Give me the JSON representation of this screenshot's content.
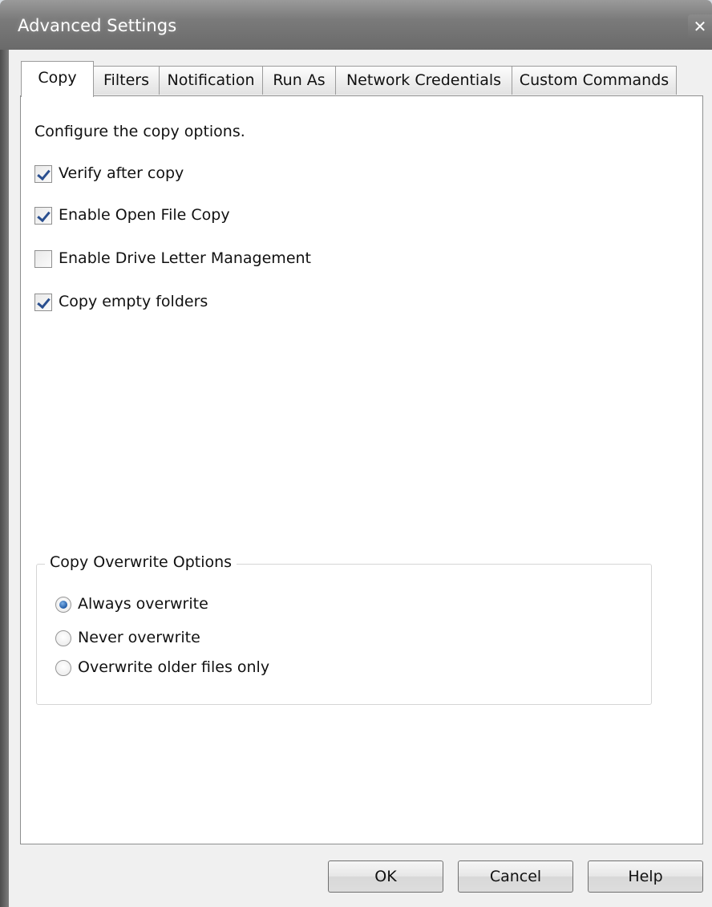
{
  "window": {
    "title": "Advanced Settings",
    "close_glyph": "✕"
  },
  "tabs": [
    {
      "label": "Copy",
      "active": true
    },
    {
      "label": "Filters",
      "active": false
    },
    {
      "label": "Notification",
      "active": false
    },
    {
      "label": "Run As",
      "active": false
    },
    {
      "label": "Network Credentials",
      "active": false
    },
    {
      "label": "Custom Commands",
      "active": false
    }
  ],
  "copy_tab": {
    "intro": "Configure the copy options.",
    "options": [
      {
        "label": "Verify after copy",
        "checked": true
      },
      {
        "label": "Enable Open File Copy",
        "checked": true
      },
      {
        "label": "Enable Drive Letter Management",
        "checked": false
      },
      {
        "label": "Copy empty folders",
        "checked": true
      }
    ],
    "overwrite_group": {
      "title": "Copy Overwrite Options",
      "choices": [
        {
          "label": "Always overwrite",
          "selected": true
        },
        {
          "label": "Never overwrite",
          "selected": false
        },
        {
          "label": "Overwrite older files only",
          "selected": false
        }
      ]
    }
  },
  "buttons": {
    "ok": "OK",
    "cancel": "Cancel",
    "help": "Help"
  },
  "icons": {
    "close": "close-icon",
    "checkmark": "checkmark-icon",
    "radio_dot": "radio-dot-icon"
  },
  "colors": {
    "titlebar": "#7a7a7a",
    "client_bg": "#f0f0f0",
    "panel_bg": "#ffffff",
    "check_accent": "#2a4f8f",
    "radio_accent": "#1f5aa6"
  }
}
